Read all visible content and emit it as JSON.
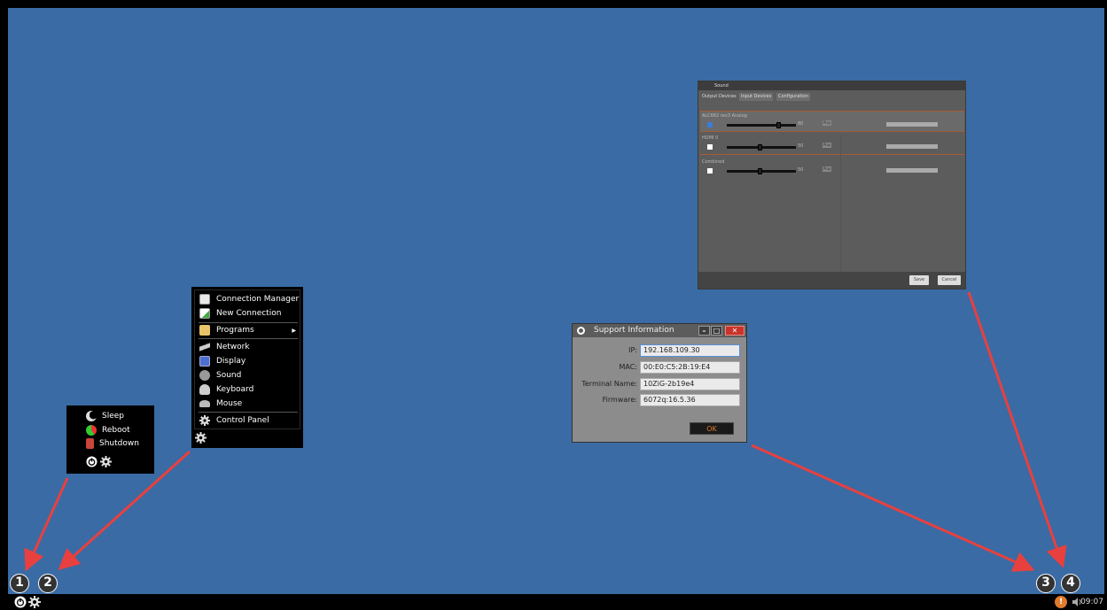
{
  "power_menu": {
    "items": [
      {
        "label": "Sleep",
        "icon": "sleep-icon"
      },
      {
        "label": "Reboot",
        "icon": "reboot-icon"
      },
      {
        "label": "Shutdown",
        "icon": "shutdown-icon"
      }
    ]
  },
  "start_menu": {
    "items": [
      {
        "label": "Connection Manager",
        "icon": "connection-manager-icon"
      },
      {
        "label": "New Connection",
        "icon": "new-connection-icon"
      },
      {
        "label": "Programs",
        "icon": "programs-folder-icon",
        "has_submenu": true
      },
      {
        "label": "Network",
        "icon": "network-icon"
      },
      {
        "label": "Display",
        "icon": "display-icon"
      },
      {
        "label": "Sound",
        "icon": "sound-icon"
      },
      {
        "label": "Keyboard",
        "icon": "keyboard-icon"
      },
      {
        "label": "Mouse",
        "icon": "mouse-icon"
      },
      {
        "label": "Control Panel",
        "icon": "gear-icon"
      }
    ]
  },
  "sound_window": {
    "title": "Sound",
    "tabs": [
      "Output Devices",
      "Input Devices",
      "Configuration"
    ],
    "devices": [
      {
        "label": "ALC662 rev3 Analog",
        "checked": true,
        "volume": 80,
        "value_text": "80",
        "button": "Play"
      },
      {
        "label": "HDMI 0",
        "checked": false,
        "volume": 50,
        "value_text": "50",
        "button": "Play"
      },
      {
        "label": "Combined",
        "checked": false,
        "volume": 50,
        "value_text": "50",
        "button": "Play"
      }
    ],
    "save_label": "Save",
    "cancel_label": "Cancel"
  },
  "support_window": {
    "title": "Support Information",
    "fields": [
      {
        "label": "IP:",
        "value": "192.168.109.30"
      },
      {
        "label": "MAC:",
        "value": "00:E0:C5:2B:19:E4"
      },
      {
        "label": "Terminal Name:",
        "value": "10ZiG-2b19e4"
      },
      {
        "label": "Firmware:",
        "value": "6072q:16.5.36"
      }
    ],
    "ok_label": "OK"
  },
  "badges": [
    "1",
    "2",
    "3",
    "4"
  ],
  "taskbar": {
    "clock": "09:07",
    "icons": [
      "power-icon",
      "gear-icon",
      "info-icon",
      "volume-icon"
    ]
  },
  "colors": {
    "desktop": "#3a6ba4",
    "arrow": "#e8403f",
    "accent": "#e07a2d"
  }
}
